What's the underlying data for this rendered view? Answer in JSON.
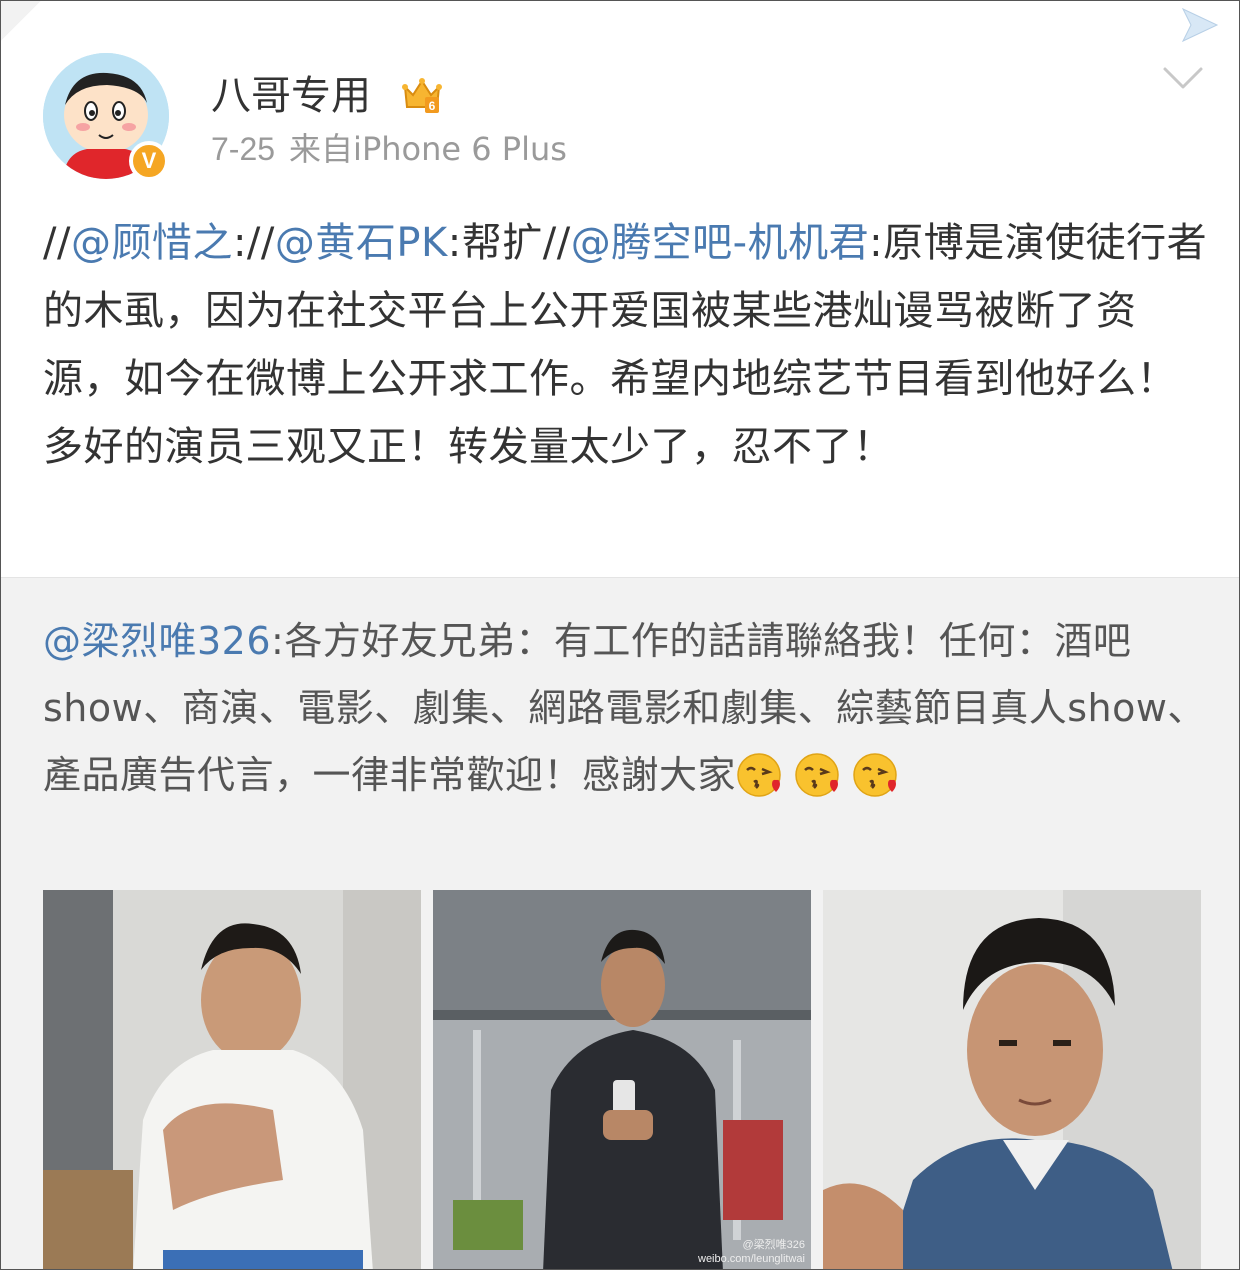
{
  "post": {
    "username": "八哥专用",
    "date": "7-25",
    "source": "来自iPhone 6 Plus",
    "verified_mark": "V",
    "text_segments": [
      {
        "t": "//",
        "mention": false
      },
      {
        "t": "@顾惜之",
        "mention": true
      },
      {
        "t": "://",
        "mention": false
      },
      {
        "t": "@黄石PK",
        "mention": true
      },
      {
        "t": ":帮扩//",
        "mention": false
      },
      {
        "t": "@腾空吧-机机君",
        "mention": true
      },
      {
        "t": ":原博是演使徒行者的木虱，因为在社交平台上公开爱国被某些港灿谩骂被断了资源，如今在微博上公开求工作。希望内地综艺节目看到他好么！多好的演员三观又正！转发量太少了，忍不了！",
        "mention": false
      }
    ]
  },
  "repost": {
    "author_mention": "@梁烈唯326",
    "text": ":各方好友兄弟：有工作的話請聯絡我！任何：酒吧show、商演、電影、劇集、網路電影和劇集、綜藝節目真人show、產品廣告代言，一律非常歡迎！感謝大家",
    "emojis": [
      "kiss-emoji",
      "kiss-emoji",
      "kiss-emoji"
    ],
    "photo_watermark_name": "@梁烈唯326",
    "photo_watermark_url": "weibo.com/leunglitwai"
  },
  "colors": {
    "mention": "#4a7ab0",
    "text": "#333333",
    "meta": "#9a9a9a",
    "repost_bg": "#f2f2f2",
    "badge": "#f5a623"
  }
}
